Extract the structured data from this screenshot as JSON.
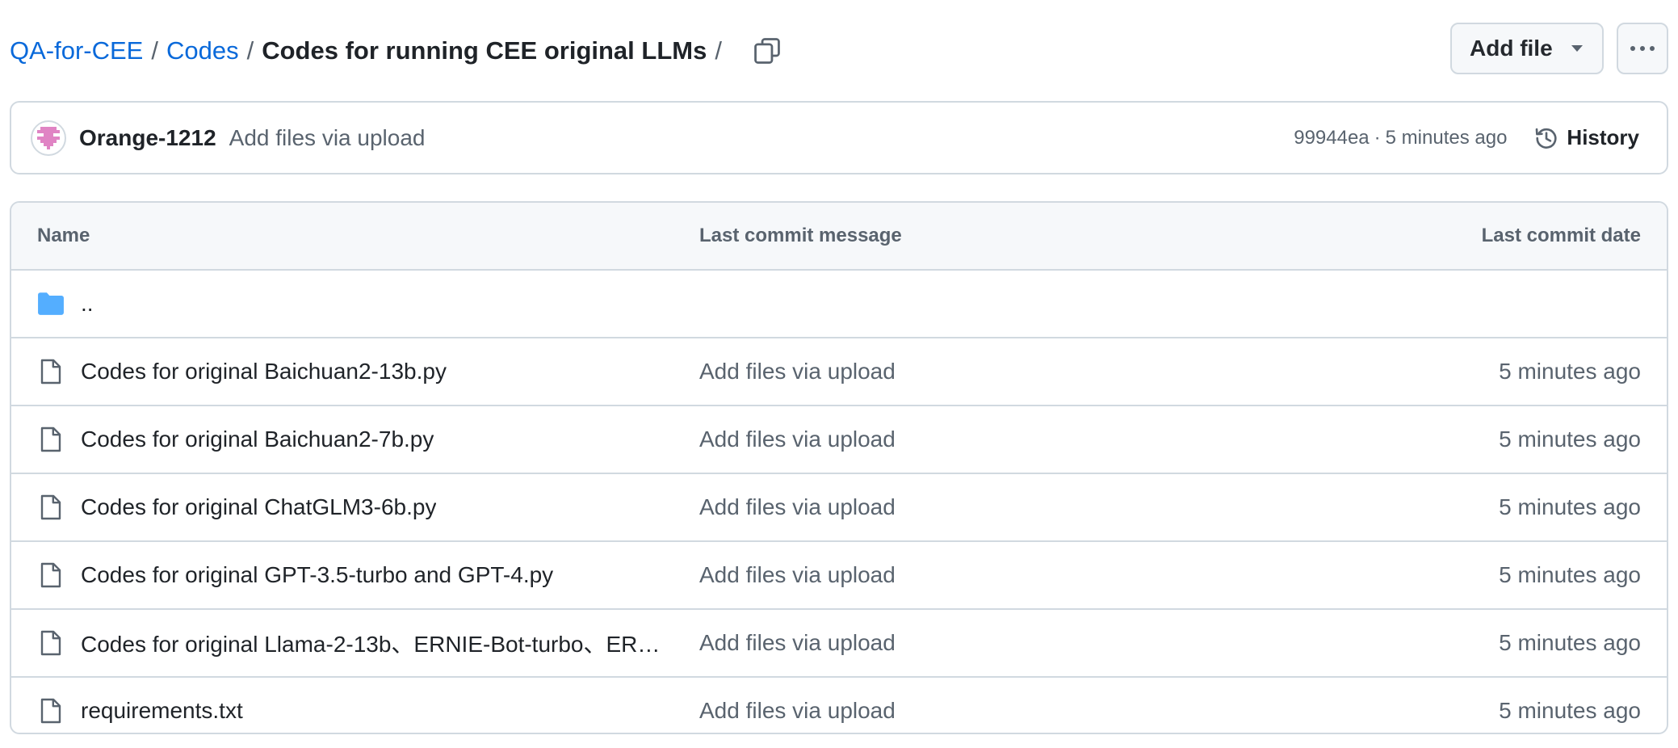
{
  "breadcrumb": {
    "repo": "QA-for-CEE",
    "folder": "Codes",
    "current": "Codes for running CEE original LLMs",
    "separator": "/"
  },
  "header_actions": {
    "add_file_label": "Add file",
    "more_icon": "kebab-horizontal-icon",
    "copy_icon": "copy-icon"
  },
  "commit": {
    "author": "Orange-1212",
    "message": "Add files via upload",
    "hash": "99944ea",
    "separator": "·",
    "time": "5 minutes ago",
    "history_label": "History"
  },
  "table": {
    "headers": {
      "name": "Name",
      "message": "Last commit message",
      "date": "Last commit date"
    },
    "parent_label": "..",
    "files": [
      {
        "name": "Codes for original Baichuan2-13b.py",
        "message": "Add files via upload",
        "date": "5 minutes ago"
      },
      {
        "name": "Codes for original Baichuan2-7b.py",
        "message": "Add files via upload",
        "date": "5 minutes ago"
      },
      {
        "name": "Codes for original ChatGLM3-6b.py",
        "message": "Add files via upload",
        "date": "5 minutes ago"
      },
      {
        "name": "Codes for original GPT-3.5-turbo and GPT-4.py",
        "message": "Add files via upload",
        "date": "5 minutes ago"
      },
      {
        "name": "Codes for original Llama-2-13b、ERNIE-Bot-turbo、ER…",
        "message": "Add files via upload",
        "date": "5 minutes ago"
      },
      {
        "name": "requirements.txt",
        "message": "Add files via upload",
        "date": "5 minutes ago"
      }
    ]
  },
  "colors": {
    "link": "#0969da",
    "text": "#1f2328",
    "muted": "#59636e",
    "border": "#d1d9e0",
    "header_bg": "#f6f8fa",
    "folder": "#54aeff"
  }
}
